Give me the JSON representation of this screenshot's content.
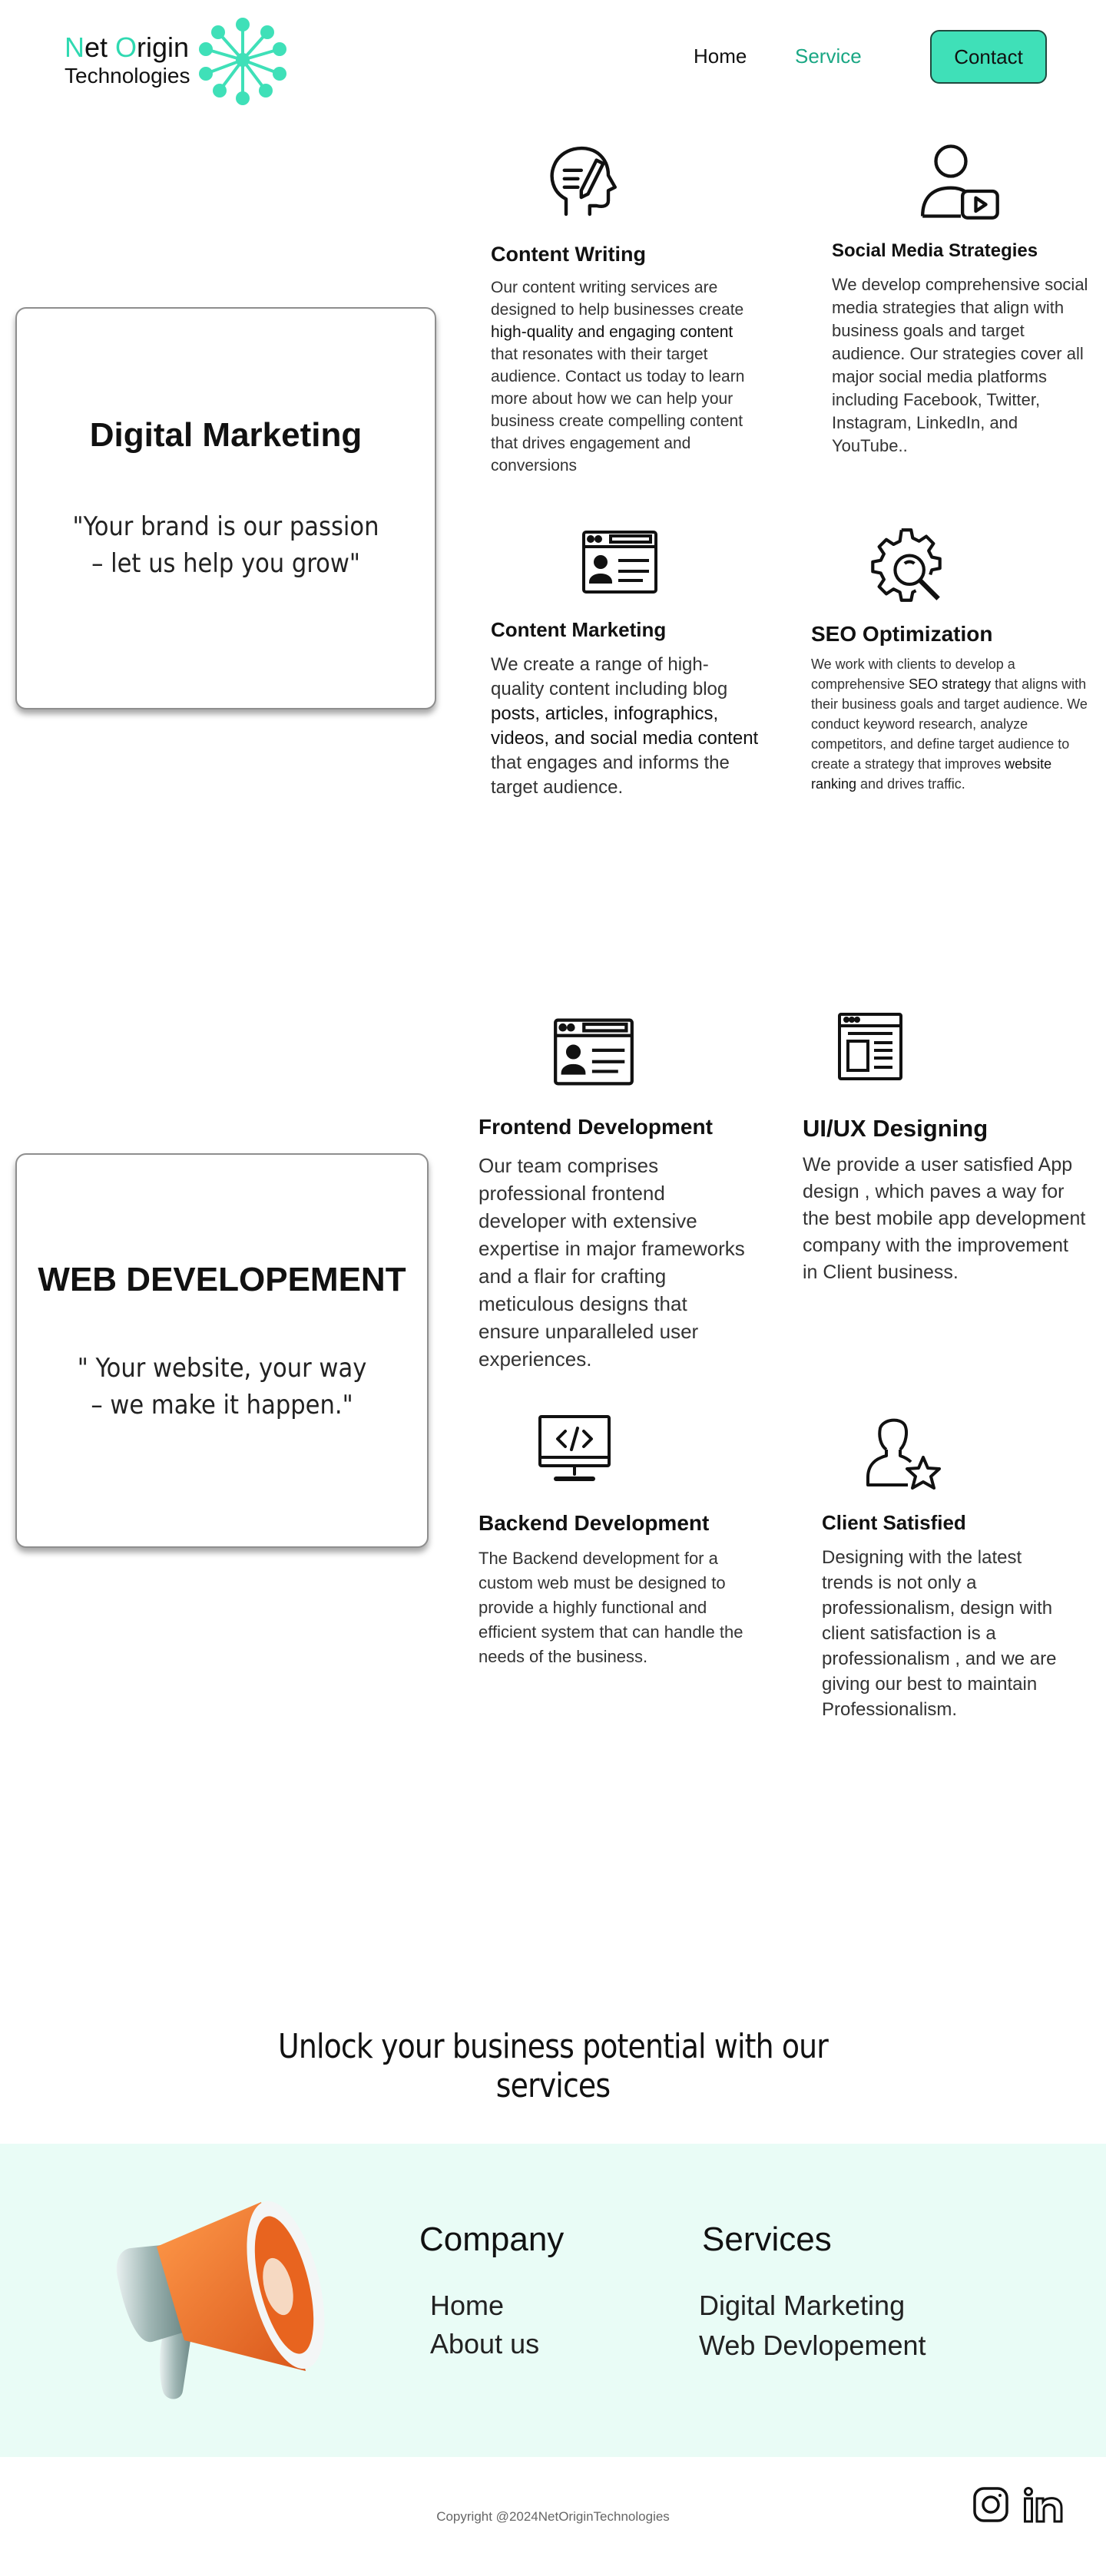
{
  "header": {
    "logo": {
      "line1_first": "N",
      "line1_mid": "et ",
      "line1_o": "O",
      "line1_rest": "rigin",
      "line2": "Technologies"
    },
    "nav": {
      "home": "Home",
      "service": "Service",
      "contact": "Contact"
    },
    "colors": {
      "accent": "#3fe0b8",
      "active_link": "#1aa784"
    }
  },
  "digital": {
    "title": "Digital Marketing",
    "quote": "\"Your brand is our passion – let us help you grow\"",
    "services": {
      "content_writing": {
        "icon": "head-pen-icon",
        "title": "Content Writing",
        "d1": "Our content writing services are designed to help businesses create ",
        "d2": "high-quality and engaging content",
        "d3": " that resonates with their target audience. Contact us today to learn more about how we can help your business create compelling content that drives engagement and conversions"
      },
      "social_media": {
        "icon": "person-video-icon",
        "title": "Social Media Strategies",
        "desc": "We develop comprehensive social media strategies that align with business goals and target audience. Our strategies cover all major social media platforms including Facebook, Twitter, Instagram, LinkedIn, and YouTube.."
      },
      "content_marketing": {
        "icon": "profile-card-icon",
        "title": "Content Marketing",
        "d1": "We create a range of high-quality content including blog ",
        "d2": "posts, articles, infographics, videos, and social media content",
        "d3": " that engages and informs the target audience."
      },
      "seo": {
        "icon": "gear-search-icon",
        "title": "SEO Optimization",
        "d1": "We work with clients to develop a comprehensive ",
        "d2": "SEO strategy",
        "d3": " that aligns with their business goals and target audience. We conduct keyword research, analyze competitors, and define target audience to create a strategy that improves ",
        "d4": "website ranking",
        "d5": " and drives traffic."
      }
    }
  },
  "web": {
    "title": "WEB DEVELOPEMENT",
    "quote": "\" Your website, your way – we make it happen.\"",
    "services": {
      "frontend": {
        "icon": "profile-card-icon",
        "title": "Frontend Development",
        "desc": "Our team comprises professional frontend developer with extensive expertise in major frameworks and a flair for crafting meticulous designs that ensure unparalleled user experiences."
      },
      "uiux": {
        "icon": "web-layout-icon",
        "title": "UI/UX Designing",
        "desc": "We provide a user satisfied App design , which paves a way for the best mobile app development company with the improvement in Client business."
      },
      "backend": {
        "icon": "monitor-code-icon",
        "title": "Backend Development",
        "desc": "The Backend development for a custom web must be designed to provide a highly functional and efficient system that can handle the needs of the business."
      },
      "client": {
        "icon": "person-star-icon",
        "title": "Client Satisfied",
        "desc": "Designing with the latest trends is not only a professionalism, design with client satisfaction is a professionalism , and we are giving our best to maintain Professionalism."
      }
    }
  },
  "cta": {
    "text": "Unlock your business potential with our services"
  },
  "footer": {
    "megaphone_icon": "megaphone-icon",
    "company": {
      "heading": "Company",
      "links": [
        "Home",
        "About us"
      ]
    },
    "services": {
      "heading": "Services",
      "links": [
        "Digital Marketing",
        "Web Devlopement"
      ]
    },
    "copyright": "Copyright @2024NetOriginTechnologies",
    "social": [
      "instagram-icon",
      "linkedin-icon"
    ],
    "band_color": "#e9fcf6"
  }
}
